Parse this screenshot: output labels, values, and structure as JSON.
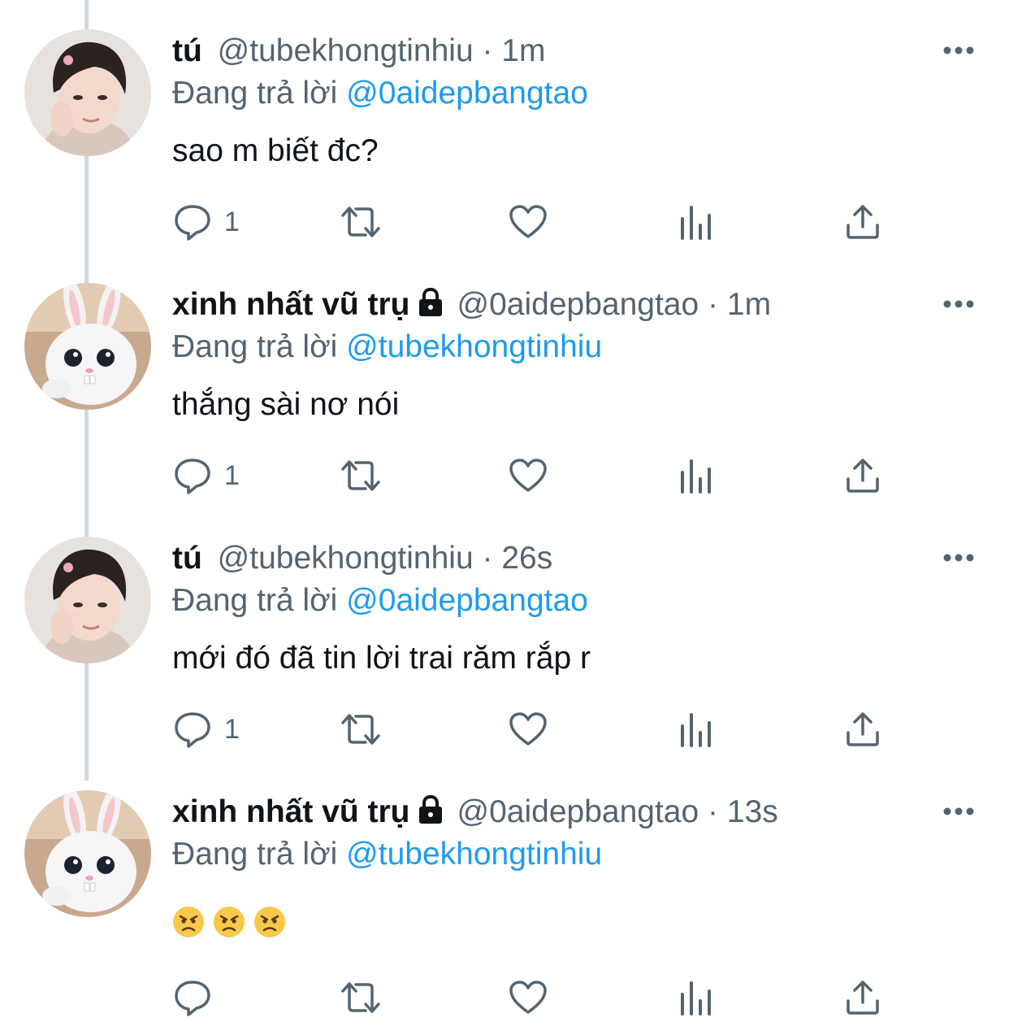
{
  "tweets": [
    {
      "name": "tú",
      "handle": "@tubekhongtinhiu",
      "separator": "·",
      "time": "1m",
      "protected": false,
      "reply_prefix": "Đang trả lời",
      "reply_to": "@0aidepbangtao",
      "text": "sao m biết đc?",
      "reply_count": "1",
      "avatar": "boy-portrait"
    },
    {
      "name": "xinh nhất vũ trụ",
      "handle": "@0aidepbangtao",
      "separator": "·",
      "time": "1m",
      "protected": true,
      "reply_prefix": "Đang trả lời",
      "reply_to": "@tubekhongtinhiu",
      "text": "thắng sài nơ nói",
      "reply_count": "1",
      "avatar": "white-bunny"
    },
    {
      "name": "tú",
      "handle": "@tubekhongtinhiu",
      "separator": "·",
      "time": "26s",
      "protected": false,
      "reply_prefix": "Đang trả lời",
      "reply_to": "@0aidepbangtao",
      "text": "mới đó đã tin lời trai răm rắp r",
      "reply_count": "1",
      "avatar": "boy-portrait"
    },
    {
      "name": "xinh nhất vũ trụ",
      "handle": "@0aidepbangtao",
      "separator": "·",
      "time": "13s",
      "protected": true,
      "reply_prefix": "Đang trả lời",
      "reply_to": "@tubekhongtinhiu",
      "text": "",
      "emojis": [
        "angry-face",
        "angry-face",
        "angry-face"
      ],
      "reply_count": "",
      "avatar": "white-bunny"
    }
  ],
  "colors": {
    "text": "#0f1419",
    "secondary": "#536471",
    "link": "#1d9bf0",
    "thread_line": "#cfd9de"
  },
  "icons": [
    "reply-icon",
    "retweet-icon",
    "like-icon",
    "views-icon",
    "share-icon",
    "more-icon",
    "lock-icon"
  ]
}
